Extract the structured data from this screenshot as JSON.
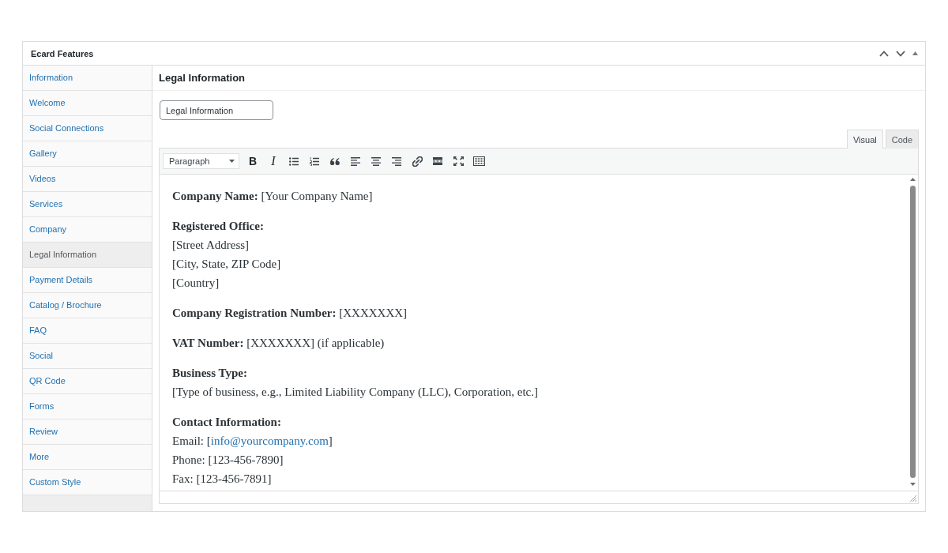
{
  "panel": {
    "title": "Ecard Features"
  },
  "sidebar": {
    "items": [
      {
        "label": "Information",
        "selected": false
      },
      {
        "label": "Welcome",
        "selected": false
      },
      {
        "label": "Social Connections",
        "selected": false
      },
      {
        "label": "Gallery",
        "selected": false
      },
      {
        "label": "Videos",
        "selected": false
      },
      {
        "label": "Services",
        "selected": false
      },
      {
        "label": "Company",
        "selected": false
      },
      {
        "label": "Legal Information",
        "selected": true
      },
      {
        "label": "Payment Details",
        "selected": false
      },
      {
        "label": "Catalog / Brochure",
        "selected": false
      },
      {
        "label": "FAQ",
        "selected": false
      },
      {
        "label": "Social",
        "selected": false
      },
      {
        "label": "QR Code",
        "selected": false
      },
      {
        "label": "Forms",
        "selected": false
      },
      {
        "label": "Review",
        "selected": false
      },
      {
        "label": "More",
        "selected": false
      },
      {
        "label": "Custom Style",
        "selected": false
      }
    ]
  },
  "section": {
    "title": "Legal Information",
    "title_field": {
      "value": "Legal Information"
    }
  },
  "editor": {
    "tabs": [
      {
        "label": "Visual",
        "selected": true
      },
      {
        "label": "Code",
        "selected": false
      }
    ],
    "toolbar": {
      "format": "Paragraph",
      "bold": "B",
      "italic": "I"
    },
    "paragraphs": [
      {
        "lines": [
          {
            "kind": "text",
            "text": "**Company Name:** [Your Company Name]"
          }
        ]
      },
      {
        "lines": [
          {
            "kind": "label",
            "text": "Registered Office:"
          },
          {
            "kind": "text",
            "text": "[Street Address]"
          },
          {
            "kind": "text",
            "text": "[City, State, ZIP Code]"
          },
          {
            "kind": "text",
            "text": "[Country]"
          }
        ]
      },
      {
        "lines": [
          {
            "kind": "text",
            "text": "**Company Registration Number:** [XXXXXXX]"
          }
        ]
      },
      {
        "lines": [
          {
            "kind": "text",
            "text": "**VAT Number:** [XXXXXXX] (if applicable)"
          }
        ]
      },
      {
        "lines": [
          {
            "kind": "label",
            "text": "Business Type:"
          },
          {
            "kind": "text",
            "text": "[Type of business, e.g., Limited Liability Company (LLC), Corporation, etc.]"
          }
        ]
      },
      {
        "lines": [
          {
            "kind": "label",
            "text": "Contact Information:"
          },
          {
            "kind": "link",
            "before": "Email: [",
            "link": "info@yourcompany.com",
            "after": "]"
          },
          {
            "kind": "text",
            "text": "Phone: [123-456-7890]"
          },
          {
            "kind": "text",
            "text": "Fax: [123-456-7891]"
          }
        ]
      }
    ]
  }
}
